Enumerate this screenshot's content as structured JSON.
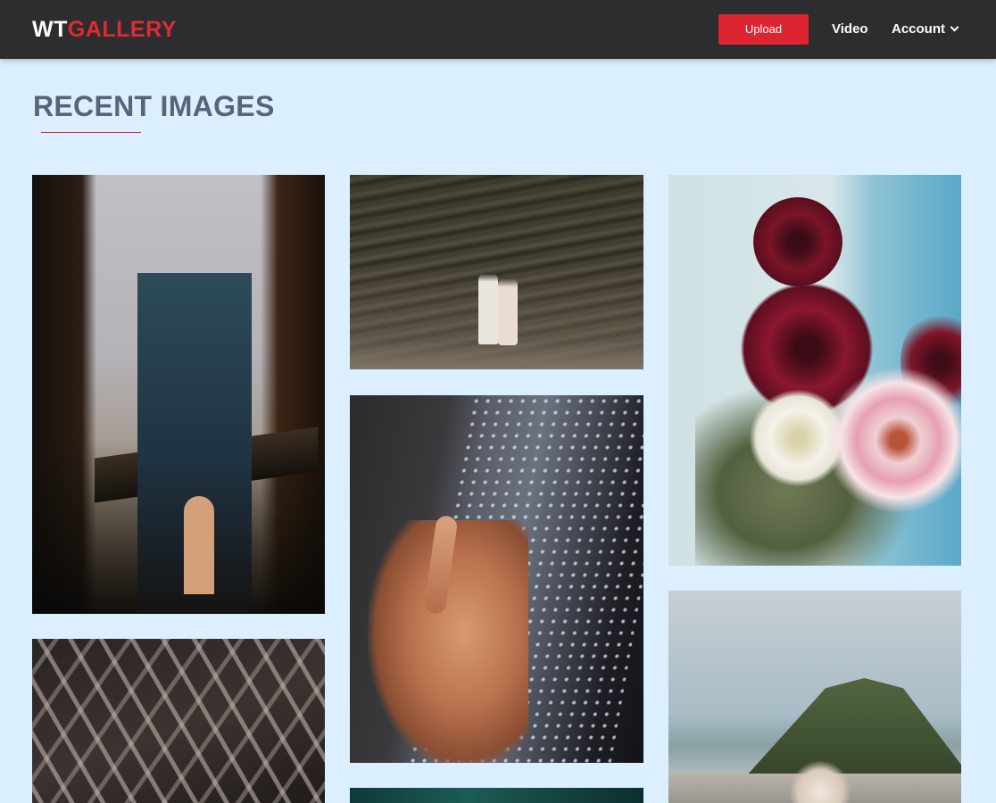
{
  "header": {
    "logo_prefix": "WT",
    "logo_suffix": "GALLERY",
    "upload_label": "Upload",
    "nav_video": "Video",
    "nav_account": "Account"
  },
  "main": {
    "section_title": "RECENT IMAGES"
  },
  "colors": {
    "brand_red": "#dc2530",
    "navbar_bg": "#2d2d2f",
    "page_bg": "#dcefff",
    "title_text": "#56657a"
  },
  "icons": {
    "account_dropdown": "chevron-down-icon"
  }
}
